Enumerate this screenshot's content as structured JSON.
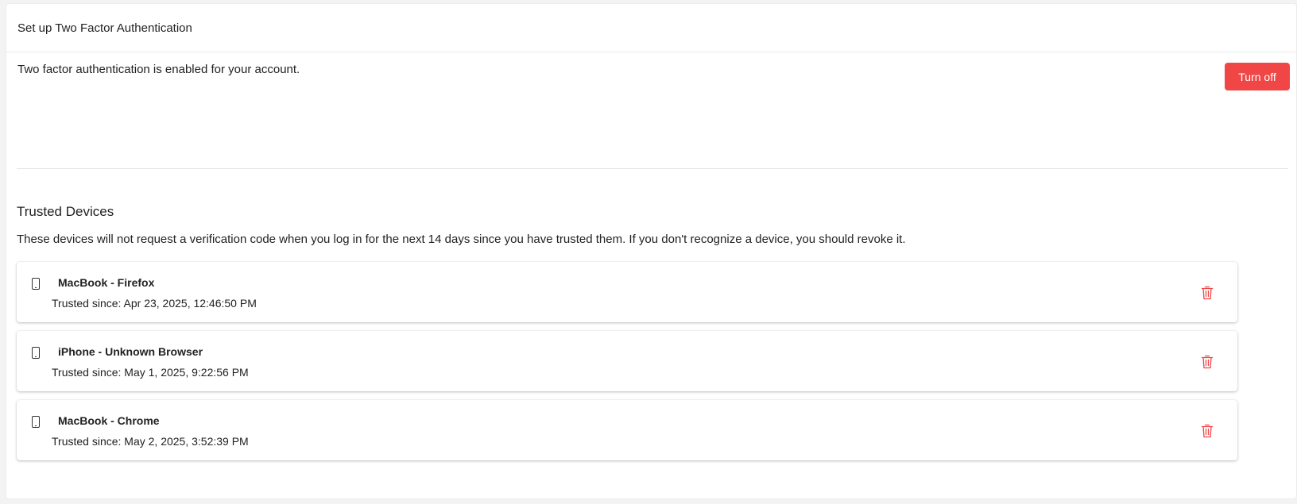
{
  "header": {
    "title": "Set up Two Factor Authentication"
  },
  "status": {
    "text": "Two factor authentication is enabled for your account.",
    "turn_off_label": "Turn off"
  },
  "trusted_devices": {
    "title": "Trusted Devices",
    "description": "These devices will not request a verification code when you log in for the next 14 days since you have trusted them. If you don't recognize a device, you should revoke it.",
    "devices": [
      {
        "name": "MacBook - Firefox",
        "since": "Trusted since: Apr 23, 2025, 12:46:50 PM",
        "icon": "mobile-device-icon"
      },
      {
        "name": "iPhone - Unknown Browser",
        "since": "Trusted since: May 1, 2025, 9:22:56 PM",
        "icon": "mobile-device-icon"
      },
      {
        "name": "MacBook - Chrome",
        "since": "Trusted since: May 2, 2025, 3:52:39 PM",
        "icon": "mobile-device-icon"
      }
    ]
  },
  "colors": {
    "danger": "#f04646",
    "trash_icon": "#f04646"
  }
}
